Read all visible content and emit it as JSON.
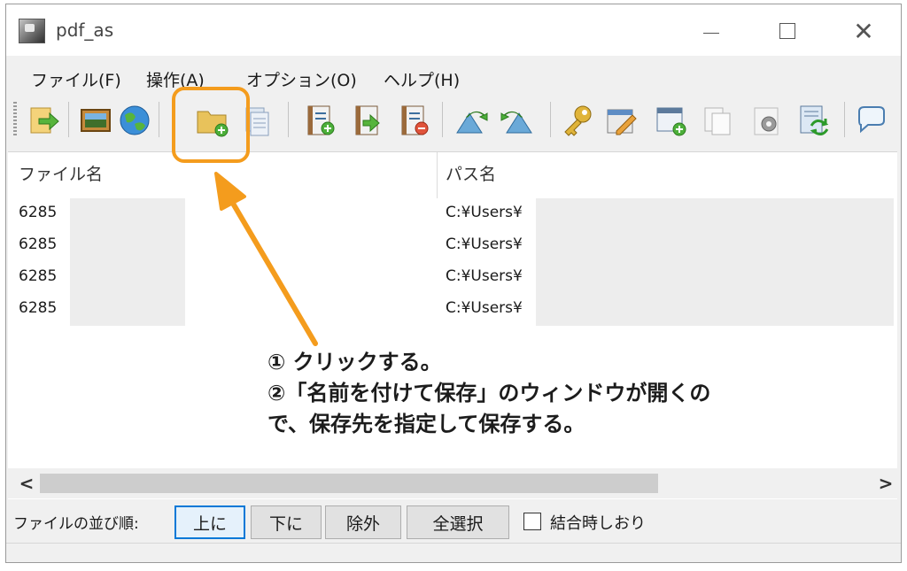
{
  "window": {
    "title": "pdf_as"
  },
  "menu": {
    "items": [
      "ファイル(F)",
      "操作(A)",
      "オプション(O)",
      "ヘルプ(H)"
    ]
  },
  "toolbar": {
    "buttons": [
      "import-arrow-icon",
      "image-icon",
      "globe-icon",
      "add-folder-icon",
      "copy-pages-icon",
      "add-page-icon",
      "insert-page-icon",
      "remove-page-icon",
      "rotate-left-icon",
      "rotate-right-icon",
      "key-icon",
      "edit-icon",
      "window-add-icon",
      "duplicate-icon",
      "settings-doc-icon",
      "refresh-doc-icon",
      "speech-bubble-icon"
    ]
  },
  "list": {
    "columns": [
      "ファイル名",
      "パス名"
    ],
    "rows": [
      {
        "file": "6285",
        "path": "C:¥Users¥"
      },
      {
        "file": "6285",
        "path": "C:¥Users¥"
      },
      {
        "file": "6285",
        "path": "C:¥Users¥"
      },
      {
        "file": "6285",
        "path": "C:¥Users¥"
      }
    ]
  },
  "scrollbar": {
    "left": "<",
    "right": ">"
  },
  "bottom": {
    "sort_label": "ファイルの並び順:",
    "buttons": [
      "上に",
      "下に",
      "除外",
      "全選択"
    ],
    "checkbox_label": "結合時しおり"
  },
  "annotation": {
    "line1": "① クリックする。",
    "line2": "②「名前を付けて保存」のウィンドウが開くの",
    "line3": "で、保存先を指定して保存する。",
    "color": "#f49c1d"
  }
}
